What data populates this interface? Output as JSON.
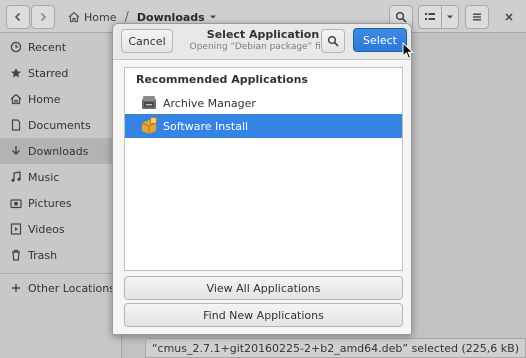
{
  "file_manager": {
    "path": {
      "home": "Home",
      "current": "Downloads"
    },
    "sidebar": [
      {
        "label": "Recent",
        "icon": "clock-icon"
      },
      {
        "label": "Starred",
        "icon": "star-icon"
      },
      {
        "label": "Home",
        "icon": "home-icon"
      },
      {
        "label": "Documents",
        "icon": "document-icon"
      },
      {
        "label": "Downloads",
        "icon": "download-icon"
      },
      {
        "label": "Music",
        "icon": "music-icon"
      },
      {
        "label": "Pictures",
        "icon": "camera-icon"
      },
      {
        "label": "Videos",
        "icon": "video-icon"
      },
      {
        "label": "Trash",
        "icon": "trash-icon"
      },
      {
        "label": "Other Locations",
        "icon": "plus-icon"
      }
    ],
    "status": "“cmus_2.7.1+git20160225-2+b2_amd64.deb” selected (225,6 kB)"
  },
  "dialog": {
    "title": "Select Application",
    "subtitle": "Opening “Debian package” files.",
    "cancel_label": "Cancel",
    "select_label": "Select",
    "section_heading": "Recommended Applications",
    "apps": [
      {
        "label": "Archive Manager",
        "icon": "archive-manager-icon",
        "selected": false
      },
      {
        "label": "Software Install",
        "icon": "software-install-icon",
        "selected": true
      }
    ],
    "view_all_label": "View All Applications",
    "find_new_label": "Find New Applications"
  },
  "colors": {
    "accent": "#3584e4",
    "selected_row": "#3584e4"
  }
}
